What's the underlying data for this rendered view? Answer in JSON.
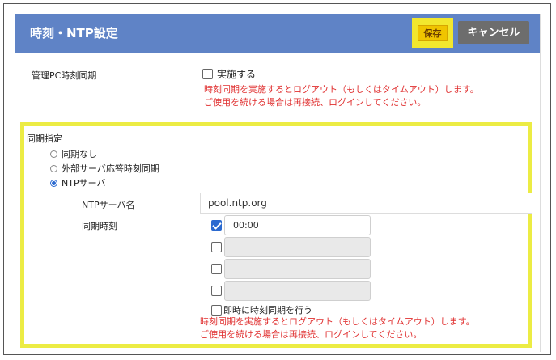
{
  "header": {
    "title": "時刻・NTP設定",
    "save_label": "保存",
    "cancel_label": "キャンセル"
  },
  "pc_sync": {
    "label": "管理PC時刻同期",
    "checkbox_label": "実施する",
    "checked": false,
    "warning_line1": "時刻同期を実施するとログアウト（もしくはタイムアウト）します。",
    "warning_line2": "ご使用を続ける場合は再接続、ログインしてください。"
  },
  "sync_mode": {
    "label": "同期指定",
    "options": [
      {
        "label": "同期なし",
        "selected": false
      },
      {
        "label": "外部サーバ応答時刻同期",
        "selected": false
      },
      {
        "label": "NTPサーバ",
        "selected": true
      }
    ]
  },
  "ntp": {
    "server_label": "NTPサーバ名",
    "server_value": "pool.ntp.org",
    "time_label": "同期時刻",
    "times": [
      {
        "checked": true,
        "value": "00:00"
      },
      {
        "checked": false,
        "value": ""
      },
      {
        "checked": false,
        "value": ""
      },
      {
        "checked": false,
        "value": ""
      }
    ],
    "immediate_label": "即時に時刻同期を行う",
    "immediate_checked": false,
    "warning_line1": "時刻同期を実施するとログアウト（もしくはタイムアウト）します。",
    "warning_line2": "ご使用を続ける場合は再接続、ログインしてください。"
  },
  "colors": {
    "header_bg": "#5f83c6",
    "highlight": "#ecec44",
    "save_bg": "#f0c400",
    "warning": "#e03030",
    "check_blue": "#2b6ad0"
  }
}
